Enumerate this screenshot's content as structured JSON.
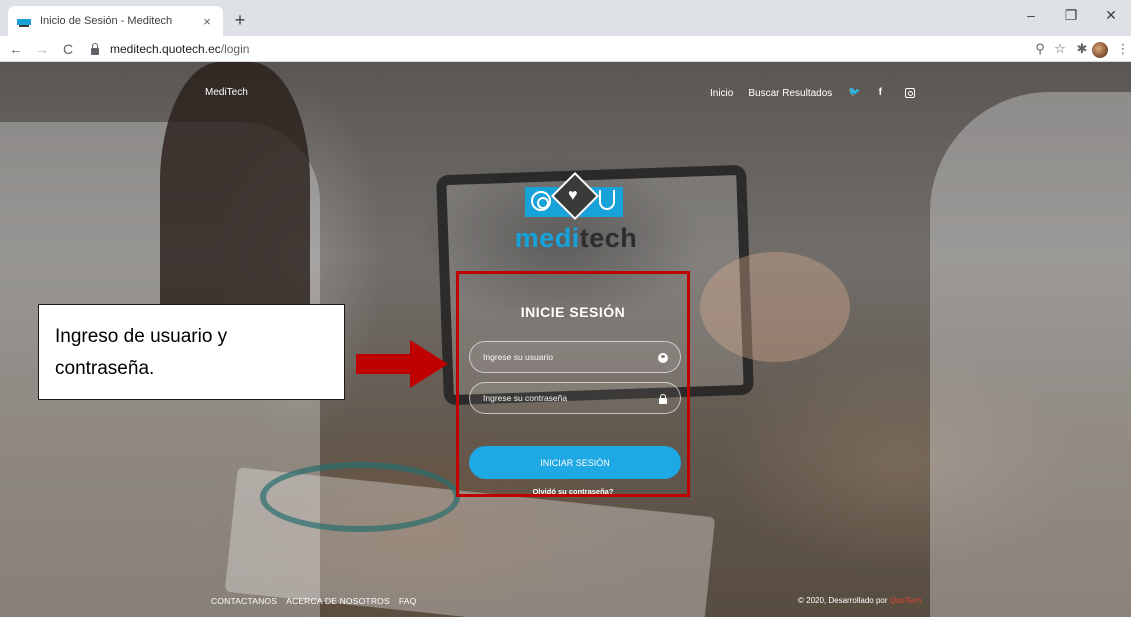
{
  "browser": {
    "tab_title": "Inicio de Sesión - Meditech",
    "tab_close": "×",
    "new_tab": "+",
    "url_domain": "meditech.quotech.ec",
    "url_path": "/login",
    "window_controls": {
      "minimize": "–",
      "maximize": "❐",
      "close": "✕"
    },
    "nav": {
      "back": "←",
      "forward": "→",
      "reload": "C"
    },
    "toolbar_icons": {
      "zoom": "⚲",
      "bookmark": "☆",
      "extensions": "✱",
      "menu": "⋮"
    }
  },
  "site_nav": {
    "brand": "MediTech",
    "links": [
      "Inicio",
      "Buscar Resultados"
    ],
    "social": {
      "twitter": "🐦",
      "facebook": "f"
    }
  },
  "logo": {
    "medi": "medi",
    "tech": "tech",
    "heart": "♥"
  },
  "login": {
    "title": "INICIE SESIÓN",
    "username_placeholder": "Ingrese su usuario",
    "password_placeholder": "Ingrese su contraseña",
    "submit_label": "INICIAR SESIÓN",
    "forgot_label": "Olvidó su contraseña?"
  },
  "annotation": {
    "line1": "Ingreso de usuario y",
    "line2": "contraseña."
  },
  "footer": {
    "links": [
      "CONTACTANOS",
      "ACERCA DE NOSOTROS",
      "FAQ"
    ],
    "copyright_prefix": "© 2020, Desarrollado por ",
    "copyright_brand": "QuoTech"
  },
  "colors": {
    "accent": "#1ea8e4",
    "annotation_red": "#c00000",
    "brand_red": "#e0442a"
  }
}
